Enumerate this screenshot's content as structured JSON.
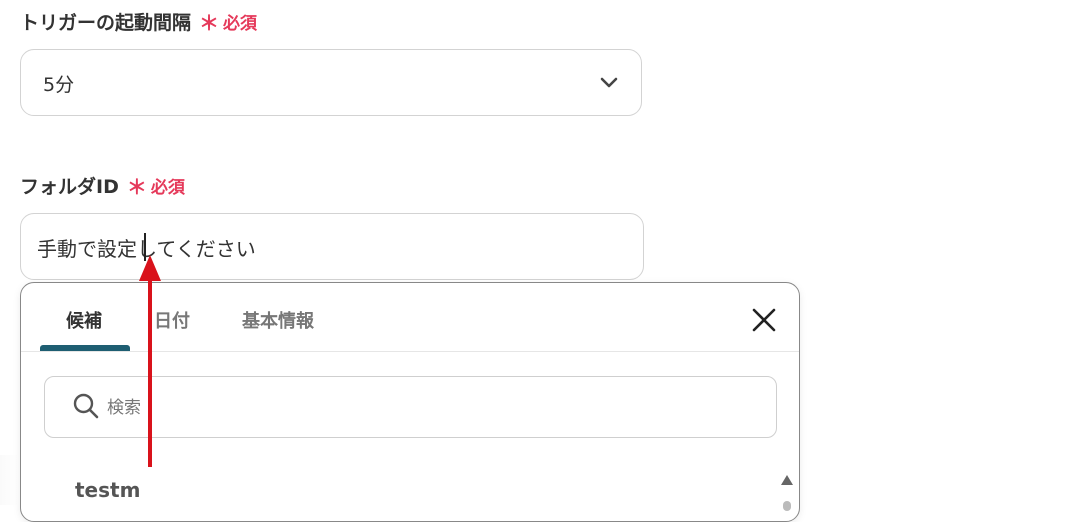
{
  "trigger_field": {
    "label": "トリガーの起動間隔",
    "required_mark": "＊",
    "required_text": "必須",
    "selected_value": "5分"
  },
  "folder_field": {
    "label": "フォルダID",
    "required_mark": "＊",
    "required_text": "必須",
    "value": "手動で設定してください"
  },
  "suggest_panel": {
    "tabs": [
      {
        "label": "候補",
        "active": true
      },
      {
        "label": "日付",
        "active": false
      },
      {
        "label": "基本情報",
        "active": false
      }
    ],
    "search_placeholder": "検索",
    "items": [
      {
        "label": "testm"
      }
    ]
  },
  "colors": {
    "required": "#e5395a",
    "active_tab_underline": "#1e5e72",
    "annotation_arrow": "#d9121b"
  },
  "icons": {
    "select_toggle": "chevron-down-icon",
    "close": "close-icon",
    "search": "search-icon",
    "scroll": "scroll-up-arrow-icon"
  }
}
